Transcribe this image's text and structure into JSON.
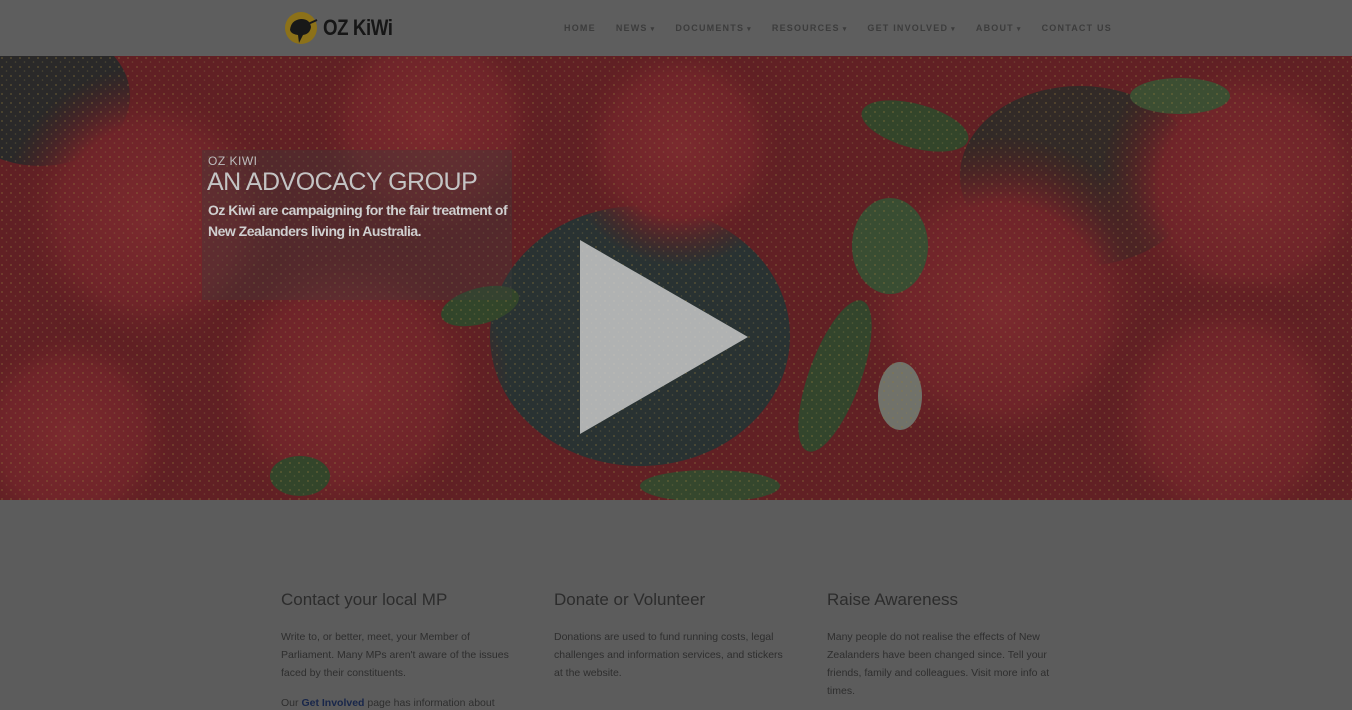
{
  "header": {
    "logo_text": "OZ KiWi",
    "nav": [
      {
        "label": "HOME",
        "dropdown": false
      },
      {
        "label": "NEWS",
        "dropdown": true
      },
      {
        "label": "DOCUMENTS",
        "dropdown": true
      },
      {
        "label": "RESOURCES",
        "dropdown": true
      },
      {
        "label": "GET INVOLVED",
        "dropdown": true
      },
      {
        "label": "ABOUT",
        "dropdown": true
      },
      {
        "label": "CONTACT US",
        "dropdown": false
      }
    ]
  },
  "hero": {
    "eyebrow": "OZ KIWI",
    "title": "AN ADVOCACY GROUP",
    "text": "Oz Kiwi are campaigning for the fair treatment of New Zealanders living in Australia.",
    "play_icon": "play-icon"
  },
  "columns": [
    {
      "heading": "Contact your local MP",
      "paragraphs": [
        "Write to, or better, meet, your Member of Parliament. Many MPs aren't aware of the issues faced by their constituents."
      ],
      "extra_prefix": "Our",
      "extra_strong": "Get Involved",
      "extra_suffix": "page has information about"
    },
    {
      "heading": "Donate or Volunteer",
      "paragraphs": [
        "Donations are used to fund running costs, legal challenges and information services, and stickers at the website."
      ]
    },
    {
      "heading": "Raise Awareness",
      "paragraphs": [
        "Many people do not realise the effects of New Zealanders have been changed since. Tell your friends, family and colleagues. Visit more info at times."
      ]
    }
  ],
  "colors": {
    "overlay": "#5b5b5b",
    "logo_yellow": "#a0811c",
    "flower_red": "#8e1a20",
    "leaf_green": "#3d5a2a"
  }
}
